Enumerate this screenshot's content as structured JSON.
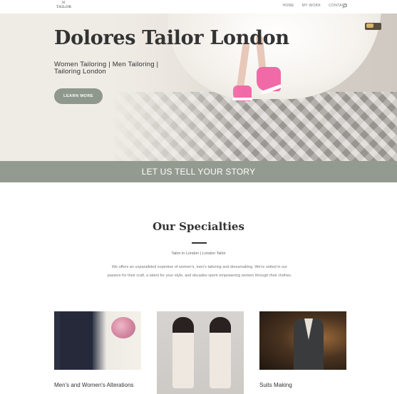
{
  "header": {
    "logo_text": "TAILOR",
    "nav": [
      "HOME",
      "MY WORK",
      "CONTACT"
    ]
  },
  "hero": {
    "title": "Dolores Tailor London",
    "subtitle": "Women Tailoring | Men Tailoring | Tailoring London",
    "button": "LEARN MORE"
  },
  "story": {
    "text": "LET US TELL YOUR STORY"
  },
  "specialties": {
    "title": "Our Specialties",
    "tagline": "Tailor in London | London Tailor",
    "description": "We offers an unparalleled expertise of women's, men's tailoring and dressmaking. We're united in our passion for their craft, a talent for your style, and decades spent empowering women through their clothes."
  },
  "cards": [
    {
      "title": "Men's and Women's Alterations"
    },
    {
      "title": ""
    },
    {
      "title": "Suits Making"
    }
  ],
  "colors": {
    "accent": "#939b90",
    "button": "#8f988c",
    "heading": "#333333"
  }
}
